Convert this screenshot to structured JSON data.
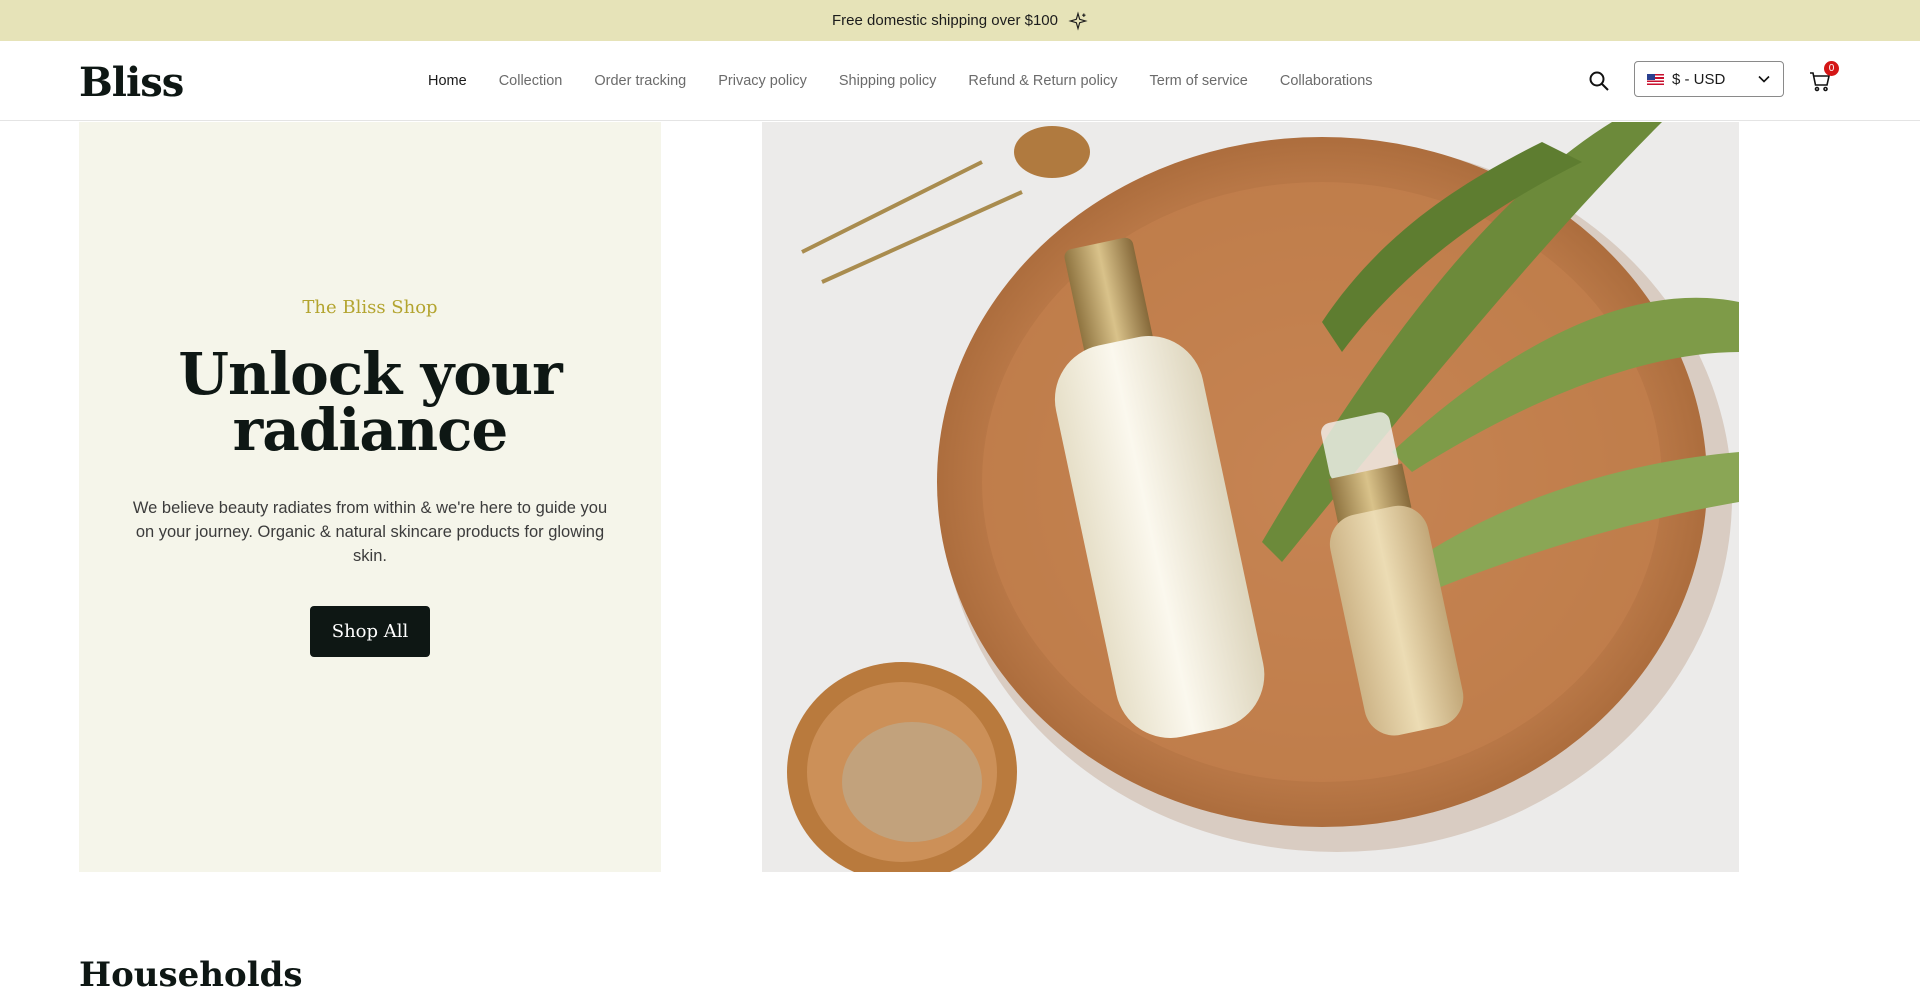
{
  "announcement": {
    "text": "Free domestic shipping over $100",
    "icon": "sparkle-icon"
  },
  "header": {
    "logo": "Bliss",
    "nav": [
      {
        "label": "Home",
        "active": true
      },
      {
        "label": "Collection"
      },
      {
        "label": "Order tracking"
      },
      {
        "label": "Privacy policy"
      },
      {
        "label": "Shipping policy"
      },
      {
        "label": "Refund & Return policy"
      },
      {
        "label": "Term of service"
      },
      {
        "label": "Collaborations"
      }
    ],
    "currency": "$ - USD",
    "cart_count": "0"
  },
  "hero": {
    "eyebrow": "The Bliss Shop",
    "headline": "Unlock your radiance",
    "subtext": "We believe beauty radiates from within & we're here to guide you on your journey. Organic & natural skincare products for glowing skin.",
    "cta": "Shop All"
  },
  "section": {
    "title": "Households"
  },
  "colors": {
    "announcement_bg": "#e6e3b8",
    "hero_panel_bg": "#f5f5ea",
    "eyebrow": "#b3a42f",
    "dark": "#0e1714",
    "badge": "#d41616"
  }
}
